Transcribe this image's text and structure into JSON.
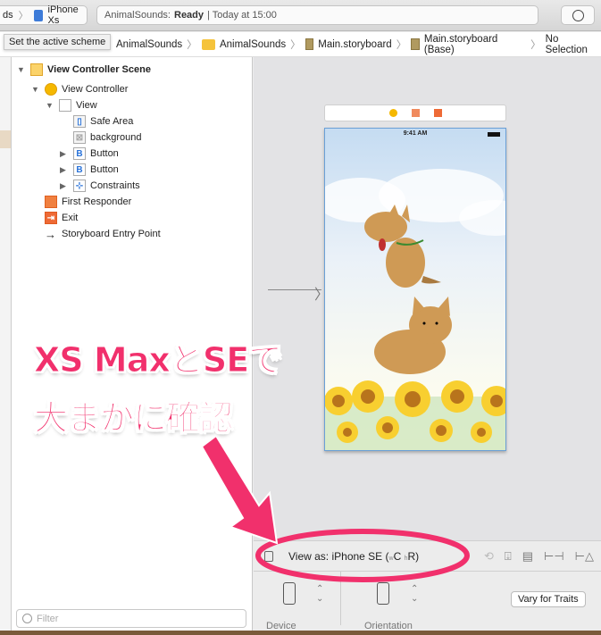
{
  "toolbar": {
    "scheme_partial": "ds",
    "device": "iPhone Xs",
    "status_app": "AnimalSounds:",
    "status_state": "Ready",
    "status_time": "| Today at 15:00"
  },
  "tooltip": "Set the active scheme",
  "jumpbar": [
    "AnimalSounds",
    "AnimalSounds",
    "Main.storyboard",
    "Main.storyboard (Base)",
    "No Selection"
  ],
  "outline": [
    {
      "label": "View Controller Scene",
      "icon": "scene-icon",
      "expanded": true
    },
    {
      "label": "View Controller",
      "icon": "view-controller-icon",
      "expanded": true
    },
    {
      "label": "View",
      "icon": "view-icon",
      "expanded": true
    },
    {
      "label": "Safe Area",
      "icon": "safe-area-icon"
    },
    {
      "label": "background",
      "icon": "image-view-icon"
    },
    {
      "label": "Button",
      "icon": "button-icon",
      "expanded": false
    },
    {
      "label": "Button",
      "icon": "button-icon",
      "expanded": false
    },
    {
      "label": "Constraints",
      "icon": "constraints-icon",
      "expanded": false
    },
    {
      "label": "First Responder",
      "icon": "first-responder-icon"
    },
    {
      "label": "Exit",
      "icon": "exit-icon"
    },
    {
      "label": "Storyboard Entry Point",
      "icon": "arrow-right-icon"
    }
  ],
  "filter_placeholder": "Filter",
  "phone": {
    "time": "9:41 AM"
  },
  "bottombar": {
    "view_as": "View as: iPhone SE (",
    "w": "w",
    "c": "C",
    "h": "h",
    "r": "R)"
  },
  "lower": {
    "device_label": "Device",
    "orientation_label": "Orientation",
    "vary_button": "Vary for Traits"
  },
  "annotation": {
    "line1": "XS MaxとSEで",
    "line2": "大まかに確認",
    "color": "#f1306c"
  }
}
